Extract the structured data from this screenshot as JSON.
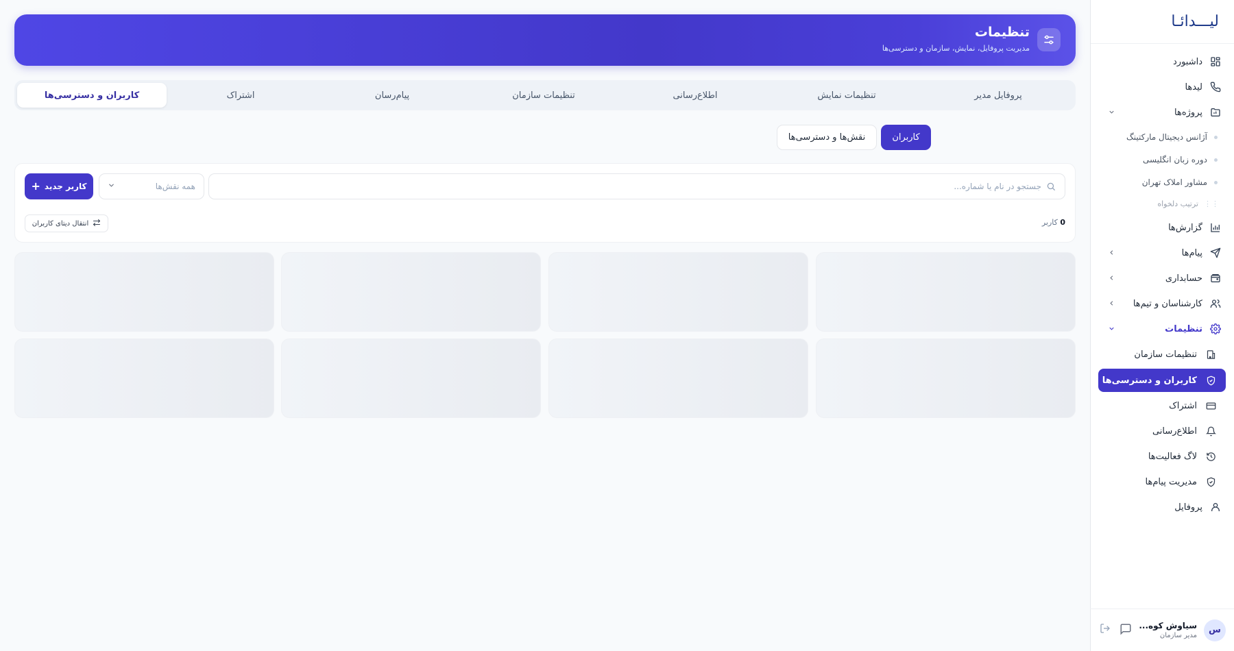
{
  "brand": {
    "logo_text": "لیـــدائـا"
  },
  "header": {
    "title": "تنظیمات",
    "subtitle": "مدیریت پروفایل، نمایش، سازمان و دسترسی‌ها",
    "icon": "sliders-icon"
  },
  "tabs": [
    {
      "label": "پروفایل مدیر",
      "active": false
    },
    {
      "label": "تنظیمات نمایش",
      "active": false
    },
    {
      "label": "اطلاع‌رسانی",
      "active": false
    },
    {
      "label": "تنظیمات سازمان",
      "active": false
    },
    {
      "label": "پیام‌رسان",
      "active": false
    },
    {
      "label": "اشتراک",
      "active": false
    },
    {
      "label": "کاربران و دسترسی‌ها",
      "active": true
    }
  ],
  "segments": {
    "users": "کاربران",
    "roles": "نقش‌ها و دسترسی‌ها",
    "active": "users"
  },
  "toolbar": {
    "search_placeholder": "جستجو در نام یا شماره...",
    "role_filter": "همه نقش‌ها",
    "add_user": "کاربر جدید",
    "user_count_num": "0",
    "user_count_label": "کاربر",
    "transfer": "انتقال دیتای کاربران"
  },
  "sidebar": {
    "items": [
      {
        "label": "داشبورد",
        "icon": "dashboard-icon"
      },
      {
        "label": "لیدها",
        "icon": "phone-icon"
      },
      {
        "label": "پروژه‌ها",
        "icon": "projects-icon"
      },
      {
        "label": "گزارش‌ها",
        "icon": "chart-icon"
      },
      {
        "label": "پیام‌ها",
        "icon": "send-icon"
      },
      {
        "label": "حسابداری",
        "icon": "wallet-icon"
      },
      {
        "label": "کارشناسان و تیم‌ها",
        "icon": "users-icon"
      },
      {
        "label": "تنظیمات",
        "icon": "gear-icon"
      },
      {
        "label": "پروفایل",
        "icon": "user-icon"
      }
    ],
    "projects": [
      "آژانس دیجیتال مارکتینگ",
      "دوره زبان انگلیسی",
      "مشاور املاک تهران"
    ],
    "custom_order": "ترتیب دلخواه",
    "settings_sub": [
      {
        "label": "تنظیمات سازمان",
        "icon": "building-icon",
        "active": false
      },
      {
        "label": "کاربران و دسترسی‌ها",
        "icon": "shield-icon",
        "active": true
      },
      {
        "label": "اشتراک",
        "icon": "card-icon",
        "active": false
      },
      {
        "label": "اطلاع‌رسانی",
        "icon": "bell-icon",
        "active": false
      },
      {
        "label": "لاگ فعالیت‌ها",
        "icon": "history-icon",
        "active": false
      },
      {
        "label": "مدیریت پیام‌ها",
        "icon": "shield-check-icon",
        "active": false
      }
    ]
  },
  "user": {
    "initial": "س",
    "name": "سیاوش کوه...",
    "role": "مدیر سازمان"
  },
  "colors": {
    "accent": "#4338ca",
    "background": "#f8fafc"
  }
}
